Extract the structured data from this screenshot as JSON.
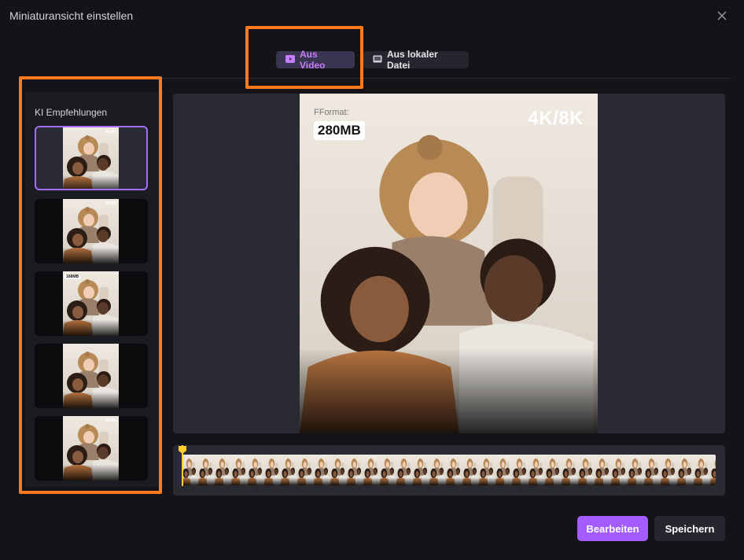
{
  "dialog": {
    "title": "Miniaturansicht einstellen",
    "close_icon": "close-icon"
  },
  "tabs": [
    {
      "label": "Aus Video",
      "icon": "video-play-icon",
      "active": true
    },
    {
      "label": "Aus lokaler Datei",
      "icon": "image-file-icon",
      "active": false
    }
  ],
  "recommendations": {
    "title": "KI Empfehlungen",
    "items": [
      {
        "label": "",
        "corner": "4K/8K",
        "selected": true
      },
      {
        "label": "",
        "corner": "4K/8K",
        "selected": false
      },
      {
        "label": "168MB",
        "corner": "",
        "selected": false
      },
      {
        "label": "",
        "corner": "",
        "selected": false
      },
      {
        "label": "",
        "corner": "4K/8K",
        "selected": false
      }
    ]
  },
  "preview": {
    "format_label": "FFormat:",
    "size_badge": "280MB",
    "resolution": "4K/8K"
  },
  "buttons": {
    "edit_label": "Bearbeiten",
    "save_label": "Speichern"
  },
  "colors": {
    "accent": "#a35cff",
    "highlight": "#ff7a1c",
    "playhead": "#ffcc33"
  }
}
